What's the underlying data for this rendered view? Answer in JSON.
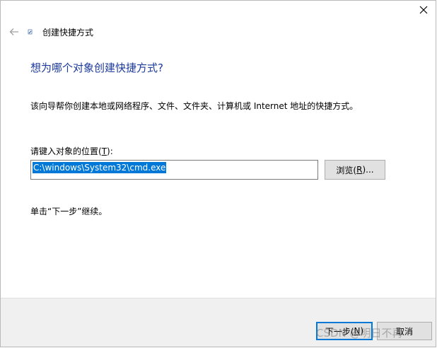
{
  "window": {
    "title": "创建快捷方式"
  },
  "page": {
    "heading": "想为哪个对象创建快捷方式?",
    "description": "该向导帮你创建本地或网络程序、文件、文件夹、计算机或 Internet 地址的快捷方式。"
  },
  "location": {
    "label_before": "请键入对象的位置(",
    "label_key": "T",
    "label_after": "):",
    "value": "C:\\windows\\System32\\cmd.exe"
  },
  "browse": {
    "label_before": "浏览(",
    "label_key": "R",
    "label_after": ")..."
  },
  "hint": "单击“下一步”继续。",
  "footer": {
    "next_before": "下一步(",
    "next_key": "N",
    "next_after": ")",
    "cancel": "取消"
  },
  "watermark": "CSDN @明日不再",
  "colors": {
    "heading": "#1c3a9b",
    "selection": "#0078d7",
    "footer_bg": "#f0f0f0",
    "button_bg": "#e1e1e1"
  },
  "icons": {
    "close": "close-icon",
    "back": "back-arrow-icon",
    "wizard": "shortcut-wizard-icon"
  }
}
